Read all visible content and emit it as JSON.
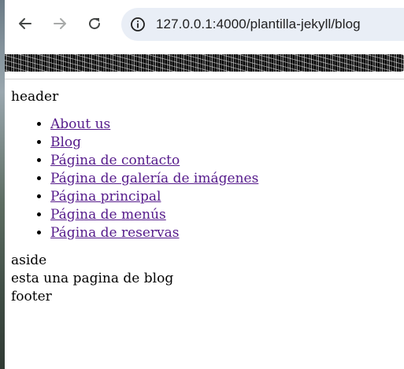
{
  "browser": {
    "url": "127.0.0.1:4000/plantilla-jekyll/blog",
    "icons": {
      "back": "arrow-left-icon",
      "forward": "arrow-right-icon",
      "reload": "reload-icon",
      "site_info": "info-icon"
    },
    "colors": {
      "omnibox_bg": "#e9eef6",
      "visited_link": "#551a8b"
    }
  },
  "page": {
    "header": "header",
    "nav_links": [
      "About us",
      "Blog",
      "Página de contacto",
      "Página de galería de imágenes",
      "Página principal",
      "Página de menús",
      "Página de reservas"
    ],
    "aside": "aside",
    "main_text": "esta una pagina de blog",
    "footer": "footer"
  }
}
